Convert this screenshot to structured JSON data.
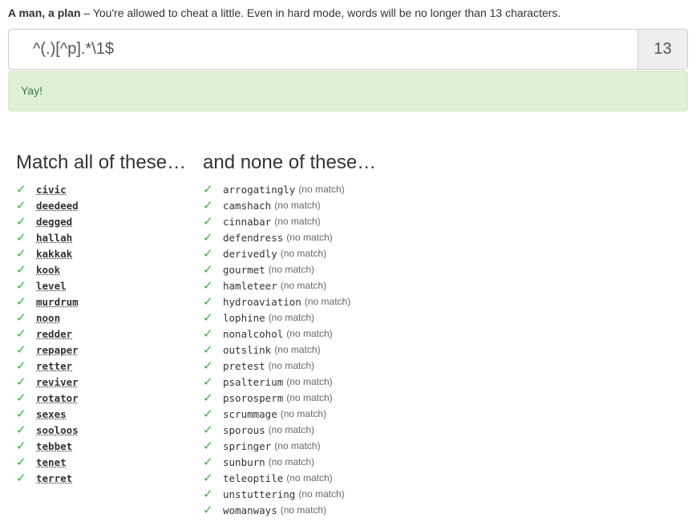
{
  "intro": {
    "title": "A man, a plan",
    "text": " – You're allowed to cheat a little. Even in hard mode, words will be no longer than 13 characters."
  },
  "regex": {
    "value": "^(.)[^p].*\\1$",
    "length": "13"
  },
  "alert": {
    "text": "Yay!"
  },
  "match": {
    "heading": "Match all of these…",
    "items": [
      "civic",
      "deedeed",
      "degged",
      "hallah",
      "kakkak",
      "kook",
      "level",
      "murdrum",
      "noon",
      "redder",
      "repaper",
      "retter",
      "reviver",
      "rotator",
      "sexes",
      "sooloos",
      "tebbet",
      "tenet",
      "terret"
    ]
  },
  "none": {
    "heading": "and none of these…",
    "status": "(no match)",
    "items": [
      "arrogatingly",
      "camshach",
      "cinnabar",
      "defendress",
      "derivedly",
      "gourmet",
      "hamleteer",
      "hydroaviation",
      "lophine",
      "nonalcohol",
      "outslink",
      "pretest",
      "psalterium",
      "psorosperm",
      "scrummage",
      "sporous",
      "springer",
      "sunburn",
      "teleoptile",
      "unstuttering",
      "womanways"
    ]
  },
  "icons": {
    "check": "checkmark-icon",
    "check_glyph": "✓",
    "check_color": "#3cad3c"
  },
  "colors": {
    "success_bg": "#dff0d8",
    "success_text": "#3c763d",
    "addon_bg": "#eeeeee"
  }
}
